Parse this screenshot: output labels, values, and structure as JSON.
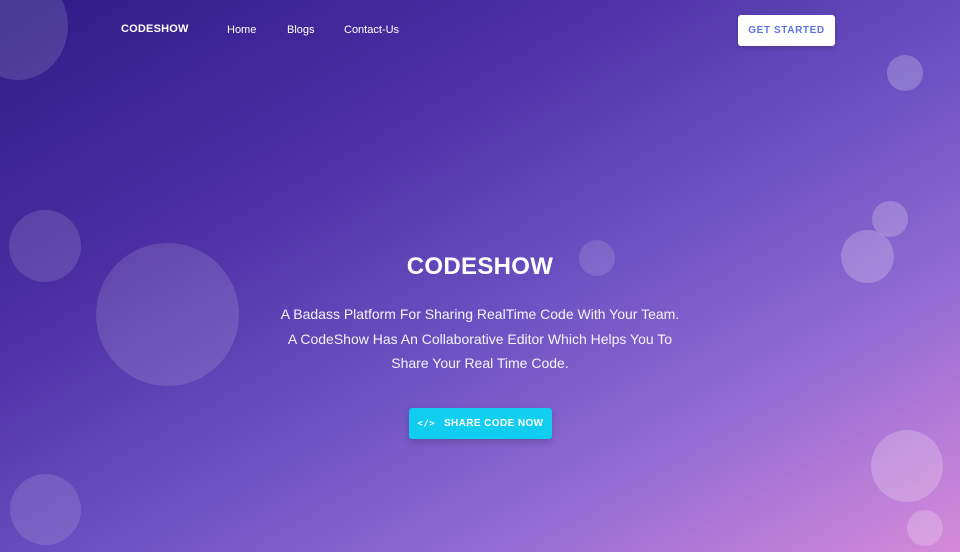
{
  "nav": {
    "brand": "CODESHOW",
    "links": [
      "Home",
      "Blogs",
      "Contact-Us"
    ],
    "cta_label": "GET STARTED"
  },
  "hero": {
    "title": "CODESHOW",
    "lines": [
      "A Badass Platform For Sharing RealTime Code With Your Team.",
      "A CodeShow Has An Collaborative Editor Which Helps You To",
      "Share Your Real Time Code."
    ],
    "cta_label": "SHARE CODE NOW",
    "cta_icon": "code-icon"
  },
  "colors": {
    "accent": "#11cdef",
    "brand_text": "#5e72e4"
  }
}
